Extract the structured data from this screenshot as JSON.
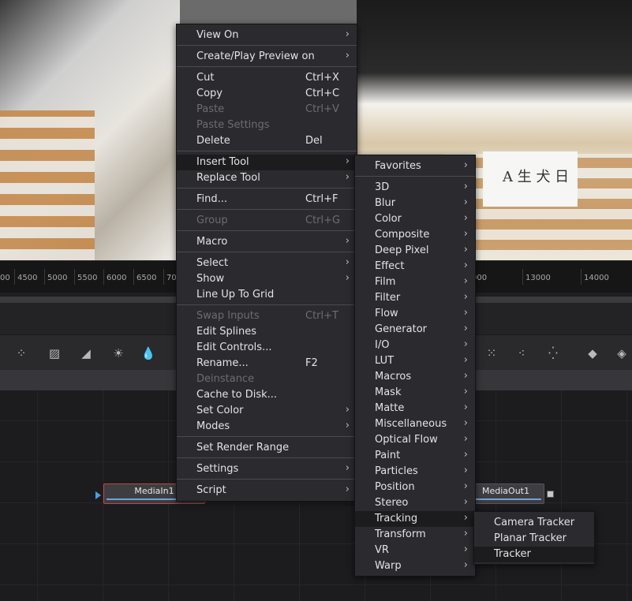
{
  "ruler": {
    "ticks": [
      "4500",
      "5000",
      "5500",
      "6000",
      "6500",
      "70",
      "000",
      "13000",
      "14000"
    ]
  },
  "viewer": {
    "note_text": "A 生 犬 日"
  },
  "nodes": {
    "media_in": "MediaIn1",
    "media_out": "MediaOut1"
  },
  "context_menu": {
    "items": [
      {
        "label": "View On",
        "shortcut": "",
        "submenu": true,
        "disabled": false
      },
      {
        "label": "Create/Play Preview on",
        "shortcut": "",
        "submenu": true,
        "disabled": false
      },
      {
        "label": "Cut",
        "shortcut": "Ctrl+X",
        "submenu": false,
        "disabled": false
      },
      {
        "label": "Copy",
        "shortcut": "Ctrl+C",
        "submenu": false,
        "disabled": false
      },
      {
        "label": "Paste",
        "shortcut": "Ctrl+V",
        "submenu": false,
        "disabled": true
      },
      {
        "label": "Paste Settings",
        "shortcut": "",
        "submenu": false,
        "disabled": true
      },
      {
        "label": "Delete",
        "shortcut": "Del",
        "submenu": false,
        "disabled": false
      },
      {
        "label": "Insert Tool",
        "shortcut": "",
        "submenu": true,
        "disabled": false,
        "highlighted": true
      },
      {
        "label": "Replace Tool",
        "shortcut": "",
        "submenu": true,
        "disabled": false
      },
      {
        "label": "Find...",
        "shortcut": "Ctrl+F",
        "submenu": false,
        "disabled": false
      },
      {
        "label": "Group",
        "shortcut": "Ctrl+G",
        "submenu": false,
        "disabled": true
      },
      {
        "label": "Macro",
        "shortcut": "",
        "submenu": true,
        "disabled": false
      },
      {
        "label": "Select",
        "shortcut": "",
        "submenu": true,
        "disabled": false
      },
      {
        "label": "Show",
        "shortcut": "",
        "submenu": true,
        "disabled": false
      },
      {
        "label": "Line Up To Grid",
        "shortcut": "",
        "submenu": false,
        "disabled": false
      },
      {
        "label": "Swap Inputs",
        "shortcut": "Ctrl+T",
        "submenu": false,
        "disabled": true
      },
      {
        "label": "Edit Splines",
        "shortcut": "",
        "submenu": false,
        "disabled": false
      },
      {
        "label": "Edit Controls...",
        "shortcut": "",
        "submenu": false,
        "disabled": false
      },
      {
        "label": "Rename...",
        "shortcut": "F2",
        "submenu": false,
        "disabled": false
      },
      {
        "label": "Deinstance",
        "shortcut": "",
        "submenu": false,
        "disabled": true
      },
      {
        "label": "Cache to Disk...",
        "shortcut": "",
        "submenu": false,
        "disabled": false
      },
      {
        "label": "Set Color",
        "shortcut": "",
        "submenu": true,
        "disabled": false
      },
      {
        "label": "Modes",
        "shortcut": "",
        "submenu": true,
        "disabled": false
      },
      {
        "label": "Set Render Range",
        "shortcut": "",
        "submenu": false,
        "disabled": false
      },
      {
        "label": "Settings",
        "shortcut": "",
        "submenu": true,
        "disabled": false
      },
      {
        "label": "Script",
        "shortcut": "",
        "submenu": true,
        "disabled": false
      }
    ]
  },
  "insert_tool_menu": {
    "items": [
      "Favorites",
      "3D",
      "Blur",
      "Color",
      "Composite",
      "Deep Pixel",
      "Effect",
      "Film",
      "Filter",
      "Flow",
      "Generator",
      "I/O",
      "LUT",
      "Macros",
      "Mask",
      "Matte",
      "Miscellaneous",
      "Optical Flow",
      "Paint",
      "Particles",
      "Position",
      "Stereo",
      "Tracking",
      "Transform",
      "VR",
      "Warp"
    ],
    "highlighted": "Tracking"
  },
  "tracking_menu": {
    "items": [
      "Camera Tracker",
      "Planar Tracker",
      "Tracker"
    ],
    "highlighted": "Tracker"
  },
  "colors": {
    "menu_bg": "#2b2b2f",
    "highlight": "#1c1c1f",
    "node_selected_border": "#c8453b",
    "accent_blue": "#6fa3d6"
  }
}
